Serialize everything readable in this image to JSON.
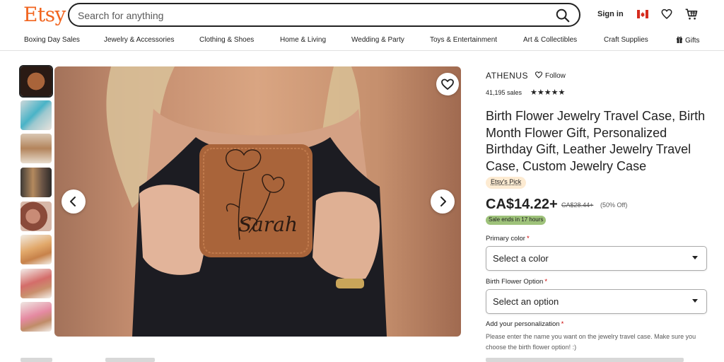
{
  "header": {
    "logo": "Etsy",
    "search_placeholder": "Search for anything",
    "sign_in": "Sign in"
  },
  "nav": {
    "items": [
      "Boxing Day Sales",
      "Jewelry & Accessories",
      "Clothing & Shoes",
      "Home & Living",
      "Wedding & Party",
      "Toys & Entertainment",
      "Art & Collectibles",
      "Craft Supplies",
      "Gifts"
    ]
  },
  "gallery": {
    "thumb_count": 8,
    "selected_index": 0,
    "engraved_name": "Sarah"
  },
  "shop": {
    "name": "ATHENUS",
    "follow": "Follow",
    "sales": "41,195 sales",
    "rating": 5,
    "stars_text": "★★★★★"
  },
  "product": {
    "title": "Birth Flower Jewelry Travel Case, Birth Month Flower Gift, Personalized Birthday Gift, Leather Jewelry Travel Case, Custom Jewelry Case",
    "badge": "Etsy's Pick",
    "price": "CA$14.22+",
    "original_price": "CA$28.44+",
    "discount": "(50% Off)",
    "sale_badge": "Sale ends in 17 hours"
  },
  "options": {
    "primary_color_label": "Primary color",
    "primary_color_value": "Select a color",
    "birth_flower_label": "Birth Flower Option",
    "birth_flower_value": "Select an option",
    "personalization_label": "Add your personalization",
    "personalization_help": "Please enter the name you want on the jewelry travel case. Make sure you choose the birth flower option! :)",
    "required_mark": "*"
  },
  "colors": {
    "brand": "#F1641E",
    "sale_badge": "#9ec27a",
    "pick_badge": "#fdebd2",
    "leather": "#a9643a"
  }
}
